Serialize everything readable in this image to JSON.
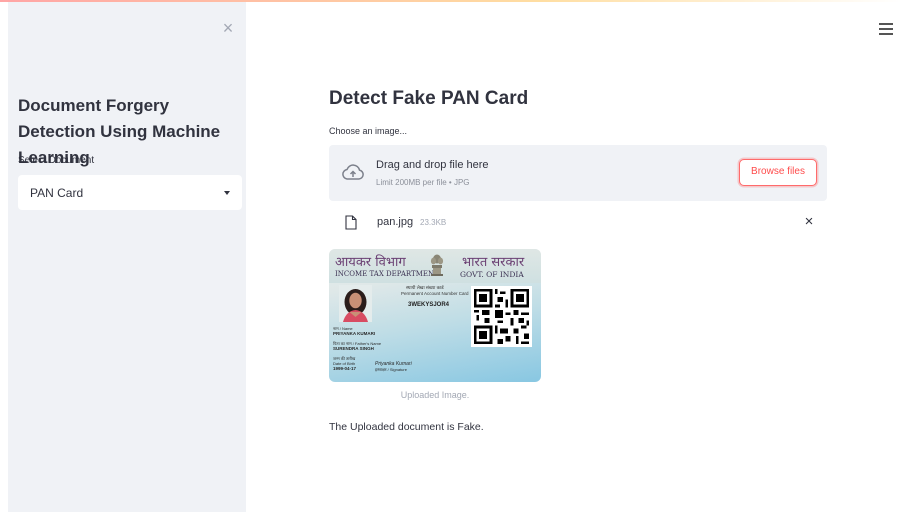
{
  "sidebar": {
    "close_glyph": "×",
    "title": "Document Forgery Detection Using Machine Learning",
    "select_label": "Select Document",
    "select_value": "PAN Card"
  },
  "header": {
    "menu_icon": "hamburger-icon"
  },
  "main": {
    "title": "Detect Fake PAN Card",
    "uploader": {
      "label": "Choose an image...",
      "drop_text": "Drag and drop file here",
      "limit_text": "Limit 200MB per file • JPG",
      "browse_label": "Browse files",
      "icon": "cloud-upload-icon"
    },
    "file": {
      "name": "pan.jpg",
      "size": "23.3KB",
      "remove_glyph": "×",
      "icon": "file-icon"
    },
    "image": {
      "header_hindi_left": "आयकर विभाग",
      "header_hindi_right": "भारत सरकार",
      "department": "INCOME TAX DEPARTMENT",
      "government": "GOVT. OF INDIA",
      "card_hindi_title": "स्थायी लेखा संख्या कार्ड",
      "card_title": "Permanent Account Number Card",
      "pan_number": "3WEKYSJOR4",
      "name_label": "नाम / Name",
      "name_value": "PRIYANKA KUMARI",
      "father_label": "पिता का नाम / Father's Name",
      "father_value": "SURENDRA SINGH",
      "dob_label_hindi": "जन्म की तारीख",
      "dob_label": "Date of Birth",
      "dob_value": "1999-04-17",
      "signature_label": "हस्ताक्षर / Signature",
      "signature_text": "Priyanka Kumari"
    },
    "caption": "Uploaded Image.",
    "result": "The Uploaded document is Fake."
  },
  "colors": {
    "sidebar_bg": "#f0f2f6",
    "accent": "#ff4b4b",
    "text": "#31333f",
    "muted": "#a3a8b4"
  }
}
